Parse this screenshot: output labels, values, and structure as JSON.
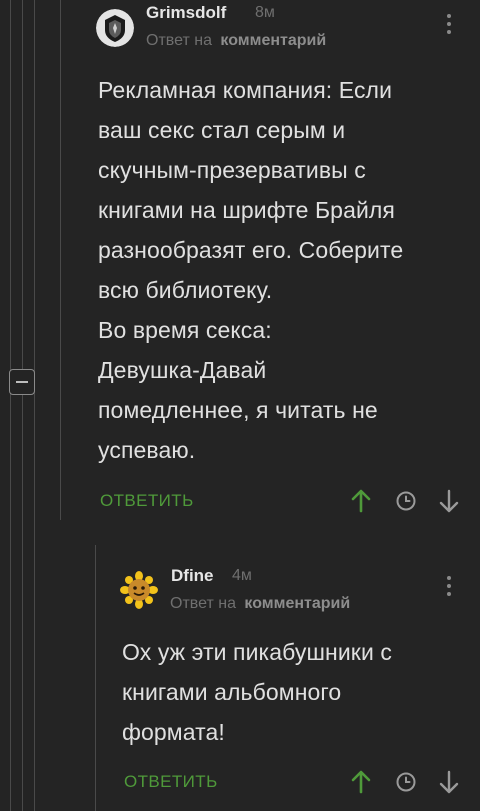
{
  "comments": [
    {
      "username": "Grimsdolf",
      "time": "8м",
      "reply_prefix": "Ответ на",
      "reply_target": "комментарий",
      "text": "Рекламная компания: Если\nваш секс стал серым и\nскучным-презервативы с\nкнигами на шрифте Брайля\nразнообразят его. Соберите\nвсю библиотеку.\nВо время секса:\nДевушка-Давай\nпомедленнее, я читать не\nуспеваю.",
      "reply_label": "ОТВЕТИТЬ"
    },
    {
      "username": "Dfine",
      "time": "4м",
      "reply_prefix": "Ответ на",
      "reply_target": "комментарий",
      "text": "Ох уж эти пикабушники с\nкнигами альбомного\nформата!",
      "reply_label": "ОТВЕТИТЬ"
    }
  ],
  "icons": {
    "menu": "vertical-dots-icon",
    "upvote": "arrow-up-icon",
    "save": "clock-icon",
    "downvote": "arrow-down-icon",
    "collapse": "minus-square-icon"
  },
  "colors": {
    "background": "#242424",
    "accent_green": "#4f9a3a",
    "muted_text": "#6f6f6f",
    "thread_line": "#4a4a4a"
  }
}
